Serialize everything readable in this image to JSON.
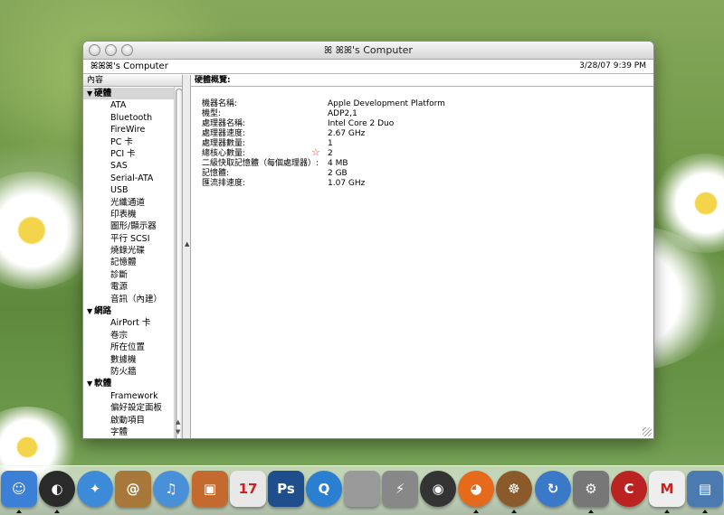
{
  "window": {
    "title": "ꕤ ꕤꕤ's Computer",
    "computer_name": "ꕤꕤꕤ's Computer",
    "timestamp": "3/28/07 9:39 PM"
  },
  "sidebar": {
    "column_header": "內容",
    "categories": [
      {
        "label": "硬體",
        "items": [
          "ATA",
          "Bluetooth",
          "FireWire",
          "PC 卡",
          "PCI 卡",
          "SAS",
          "Serial-ATA",
          "USB",
          "光纖通道",
          "印表機",
          "圖形/顯示器",
          "平行 SCSI",
          "燒錄光碟",
          "記憶體",
          "診斷",
          "電源",
          "音訊（內建）"
        ]
      },
      {
        "label": "網路",
        "items": [
          "AirPort 卡",
          "卷宗",
          "所在位置",
          "數據機",
          "防火牆"
        ]
      },
      {
        "label": "軟體",
        "items": [
          "Framework",
          "偏好設定面板",
          "啟動項目",
          "字體"
        ]
      }
    ]
  },
  "detail": {
    "header": "硬體概覽:",
    "rows": [
      {
        "k": "機器名稱:",
        "v": "Apple Development Platform"
      },
      {
        "k": "機型:",
        "v": "ADP2,1"
      },
      {
        "k": "處理器名稱:",
        "v": "Intel Core 2 Duo"
      },
      {
        "k": "處理器速度:",
        "v": "2.67 GHz"
      },
      {
        "k": "處理器數量:",
        "v": "1"
      },
      {
        "k": "總核心數量:",
        "v": "2"
      },
      {
        "k": "二級快取記憶體（每個處理器）:",
        "v": "4 MB"
      },
      {
        "k": "記憶體:",
        "v": "2 GB"
      },
      {
        "k": "匯流排速度:",
        "v": "1.07 GHz"
      }
    ]
  },
  "dock": {
    "icons": [
      {
        "name": "finder-icon",
        "color": "#3b7fd6",
        "glyph": "☺",
        "round": false,
        "running": true
      },
      {
        "name": "dashboard-icon",
        "color": "#2a2a2a",
        "glyph": "◐",
        "round": true,
        "running": true
      },
      {
        "name": "safari-icon",
        "color": "#3d8ad8",
        "glyph": "✦",
        "round": true,
        "running": false
      },
      {
        "name": "address-book-icon",
        "color": "#a8783a",
        "glyph": "@",
        "round": false,
        "running": false
      },
      {
        "name": "itunes-icon",
        "color": "#4a90d9",
        "glyph": "♫",
        "round": true,
        "running": false
      },
      {
        "name": "iphoto-icon",
        "color": "#c46a2e",
        "glyph": "▣",
        "round": false,
        "running": false
      },
      {
        "name": "ical-icon",
        "color": "#e8e8e8",
        "glyph": "17",
        "round": false,
        "running": false
      },
      {
        "name": "photoshop-icon",
        "color": "#1f4e8c",
        "glyph": "Ps",
        "round": false,
        "running": false
      },
      {
        "name": "quicktime-icon",
        "color": "#2a7fd0",
        "glyph": "Q",
        "round": true,
        "running": false
      },
      {
        "name": "system-preferences-icon",
        "color": "#9a9a9a",
        "glyph": "",
        "round": false,
        "running": false
      },
      {
        "name": "network-icon",
        "color": "#888",
        "glyph": "⚡",
        "round": false,
        "running": false
      },
      {
        "name": "camera-icon",
        "color": "#333",
        "glyph": "◉",
        "round": true,
        "running": false
      },
      {
        "name": "firefox-icon",
        "color": "#e66a1c",
        "glyph": "◕",
        "round": true,
        "running": true
      },
      {
        "name": "helm-icon",
        "color": "#8a5a2a",
        "glyph": "☸",
        "round": true,
        "running": true
      },
      {
        "name": "sync-icon",
        "color": "#3a78c8",
        "glyph": "↻",
        "round": true,
        "running": false
      },
      {
        "name": "utility-icon",
        "color": "#777",
        "glyph": "⚙",
        "round": false,
        "running": true
      },
      {
        "name": "app-c-icon",
        "color": "#b22",
        "glyph": "C",
        "round": true,
        "running": false
      },
      {
        "name": "app-m-icon",
        "color": "#eee",
        "glyph": "M",
        "round": false,
        "running": true
      },
      {
        "name": "preview-icon",
        "color": "#4a7ab0",
        "glyph": "▤",
        "round": false,
        "running": true
      }
    ]
  }
}
